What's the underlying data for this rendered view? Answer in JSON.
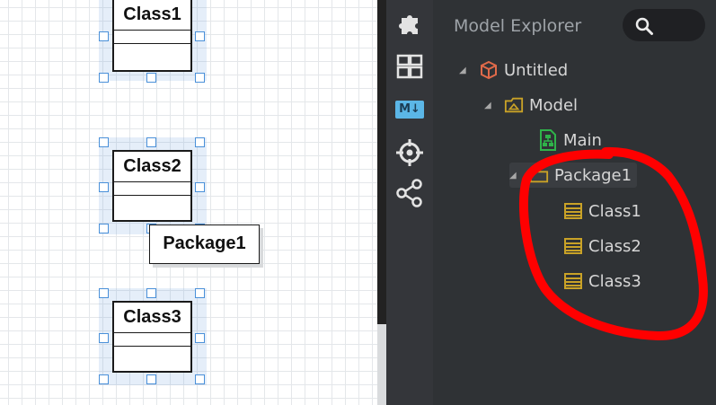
{
  "diagram": {
    "classes": [
      {
        "name": "Class1"
      },
      {
        "name": "Class2"
      },
      {
        "name": "Class3"
      }
    ],
    "package_label": "Package1"
  },
  "sidebar": {
    "icons": [
      "extensions-icon",
      "layout-icon",
      "markdown-icon",
      "crosshair-icon",
      "share-icon"
    ],
    "markdown_label": "M↓"
  },
  "explorer": {
    "title": "Model Explorer",
    "tree": [
      {
        "label": "Untitled",
        "icon": "project-icon",
        "expanded": true
      },
      {
        "label": "Model",
        "icon": "model-icon",
        "expanded": true
      },
      {
        "label": "Main",
        "icon": "diagram-icon"
      },
      {
        "label": "Package1",
        "icon": "folder-icon",
        "expanded": true,
        "selected": true
      },
      {
        "label": "Class1",
        "icon": "class-icon"
      },
      {
        "label": "Class2",
        "icon": "class-icon"
      },
      {
        "label": "Class3",
        "icon": "class-icon"
      }
    ]
  },
  "colors": {
    "annotation": "#ff0000",
    "handle": "#4a90d9",
    "class_icon": "#c9a227",
    "diagram_icon": "#2fb34a",
    "project_icon": "#e06a4a"
  }
}
